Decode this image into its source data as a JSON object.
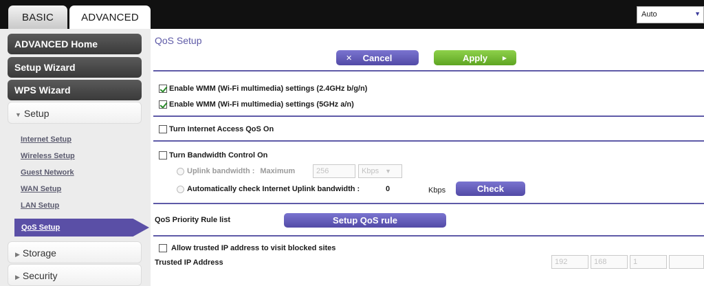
{
  "tabs": {
    "basic": "BASIC",
    "advanced": "ADVANCED"
  },
  "language": {
    "value": "Auto"
  },
  "sidebar": {
    "advanced_home": "ADVANCED Home",
    "setup_wizard": "Setup Wizard",
    "wps_wizard": "WPS Wizard",
    "setup": "Setup",
    "links": [
      "Internet Setup",
      "Wireless Setup",
      "Guest Network",
      "WAN Setup",
      "LAN Setup"
    ],
    "active_link": "QoS Setup",
    "storage": "Storage",
    "security": "Security"
  },
  "page": {
    "title": "QoS Setup",
    "cancel": "Cancel",
    "apply": "Apply"
  },
  "wmm": {
    "opt_24": {
      "label": "Enable WMM (Wi-Fi multimedia) settings (2.4GHz b/g/n)",
      "checked": true
    },
    "opt_5": {
      "label": "Enable WMM (Wi-Fi multimedia) settings (5GHz a/n)",
      "checked": true
    }
  },
  "qos": {
    "label": "Turn Internet Access QoS On",
    "checked": false
  },
  "bandwidth": {
    "label": "Turn Bandwidth Control On",
    "checked": false,
    "uplink_label": "Uplink bandwidth :",
    "maximum_label": "Maximum",
    "maximum_value": "256",
    "unit_select": "Kbps",
    "auto_label": "Automatically check Internet Uplink bandwidth :",
    "auto_value": "0",
    "auto_unit": "Kbps",
    "check_button": "Check"
  },
  "priority": {
    "label": "QoS Priority Rule list",
    "button": "Setup QoS rule"
  },
  "trusted": {
    "allow_label": "Allow trusted IP address to visit blocked sites",
    "checked": false,
    "ip_label": "Trusted IP Address",
    "ip": [
      "192",
      "168",
      "1",
      ""
    ]
  }
}
